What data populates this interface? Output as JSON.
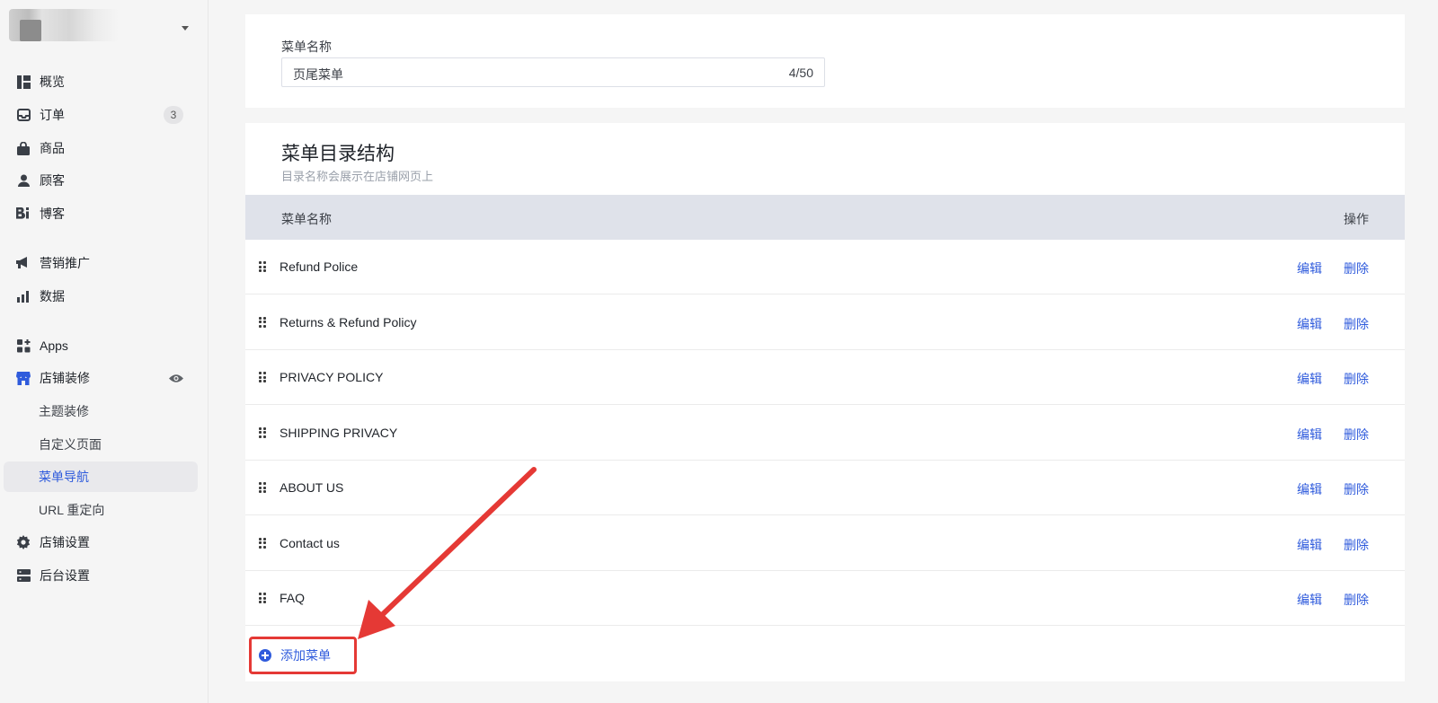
{
  "sidebar": {
    "items": [
      {
        "label": "概览",
        "icon": "dashboard-icon"
      },
      {
        "label": "订单",
        "icon": "inbox-icon",
        "badge": "3"
      },
      {
        "label": "商品",
        "icon": "shopping-bag-icon"
      },
      {
        "label": "顾客",
        "icon": "person-icon"
      },
      {
        "label": "博客",
        "icon": "blog-icon"
      },
      {
        "label": "营销推广",
        "icon": "megaphone-icon"
      },
      {
        "label": "数据",
        "icon": "bar-chart-icon"
      },
      {
        "label": "Apps",
        "icon": "apps-icon"
      },
      {
        "label": "店铺装修",
        "icon": "storefront-icon"
      },
      {
        "label": "主题装修"
      },
      {
        "label": "自定义页面"
      },
      {
        "label": "菜单导航",
        "active": true
      },
      {
        "label": "URL 重定向"
      },
      {
        "label": "店铺设置",
        "icon": "gear-icon"
      },
      {
        "label": "后台设置",
        "icon": "server-icon"
      }
    ]
  },
  "menu_name_field": {
    "label": "菜单名称",
    "value": "页尾菜单",
    "counter": "4/50"
  },
  "structure": {
    "title": "菜单目录结构",
    "subtitle": "目录名称会展示在店铺网页上",
    "col_name": "菜单名称",
    "col_action": "操作",
    "edit_label": "编辑",
    "delete_label": "删除",
    "rows": [
      {
        "name": "Refund Police"
      },
      {
        "name": "Returns & Refund Policy"
      },
      {
        "name": "PRIVACY POLICY"
      },
      {
        "name": "SHIPPING PRIVACY"
      },
      {
        "name": "ABOUT US"
      },
      {
        "name": "Contact us"
      },
      {
        "name": "FAQ"
      }
    ],
    "add_label": "添加菜单"
  },
  "colors": {
    "accent": "#2f5bdc",
    "highlight": "#e53935"
  }
}
